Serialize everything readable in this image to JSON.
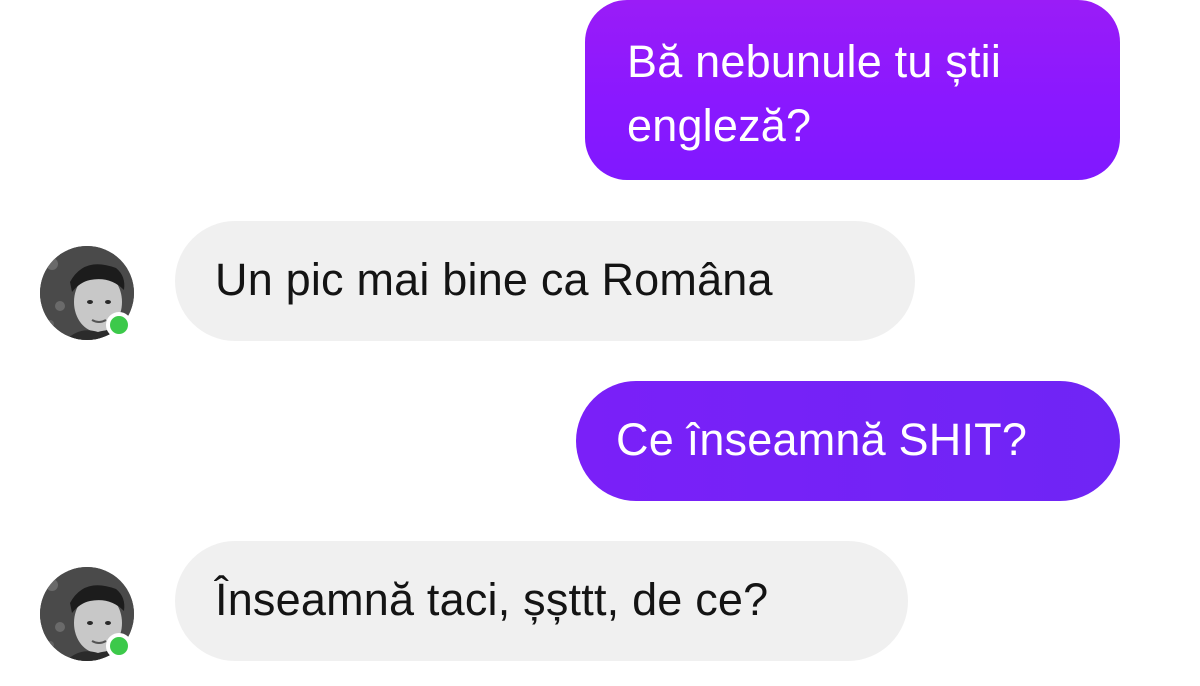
{
  "messages": [
    {
      "id": "msg1",
      "direction": "outgoing",
      "text": "Bă nebunule tu știi engleză?"
    },
    {
      "id": "msg2",
      "direction": "incoming",
      "text": "Un pic mai bine ca Româna"
    },
    {
      "id": "msg3",
      "direction": "outgoing",
      "text": "Ce înseamnă SHIT?"
    },
    {
      "id": "msg4",
      "direction": "incoming",
      "text": "Înseamnă taci, șșttt, de ce?"
    }
  ],
  "contact": {
    "avatar_icon": "avatar-photo",
    "status_icon": "online-status-dot",
    "online": true
  },
  "colors": {
    "sent_bubble_1": "#8a18ff",
    "sent_bubble_2": "#7022f6",
    "received_bubble": "#f0f0f0",
    "online": "#3cc94a",
    "text_dark": "#141414"
  }
}
